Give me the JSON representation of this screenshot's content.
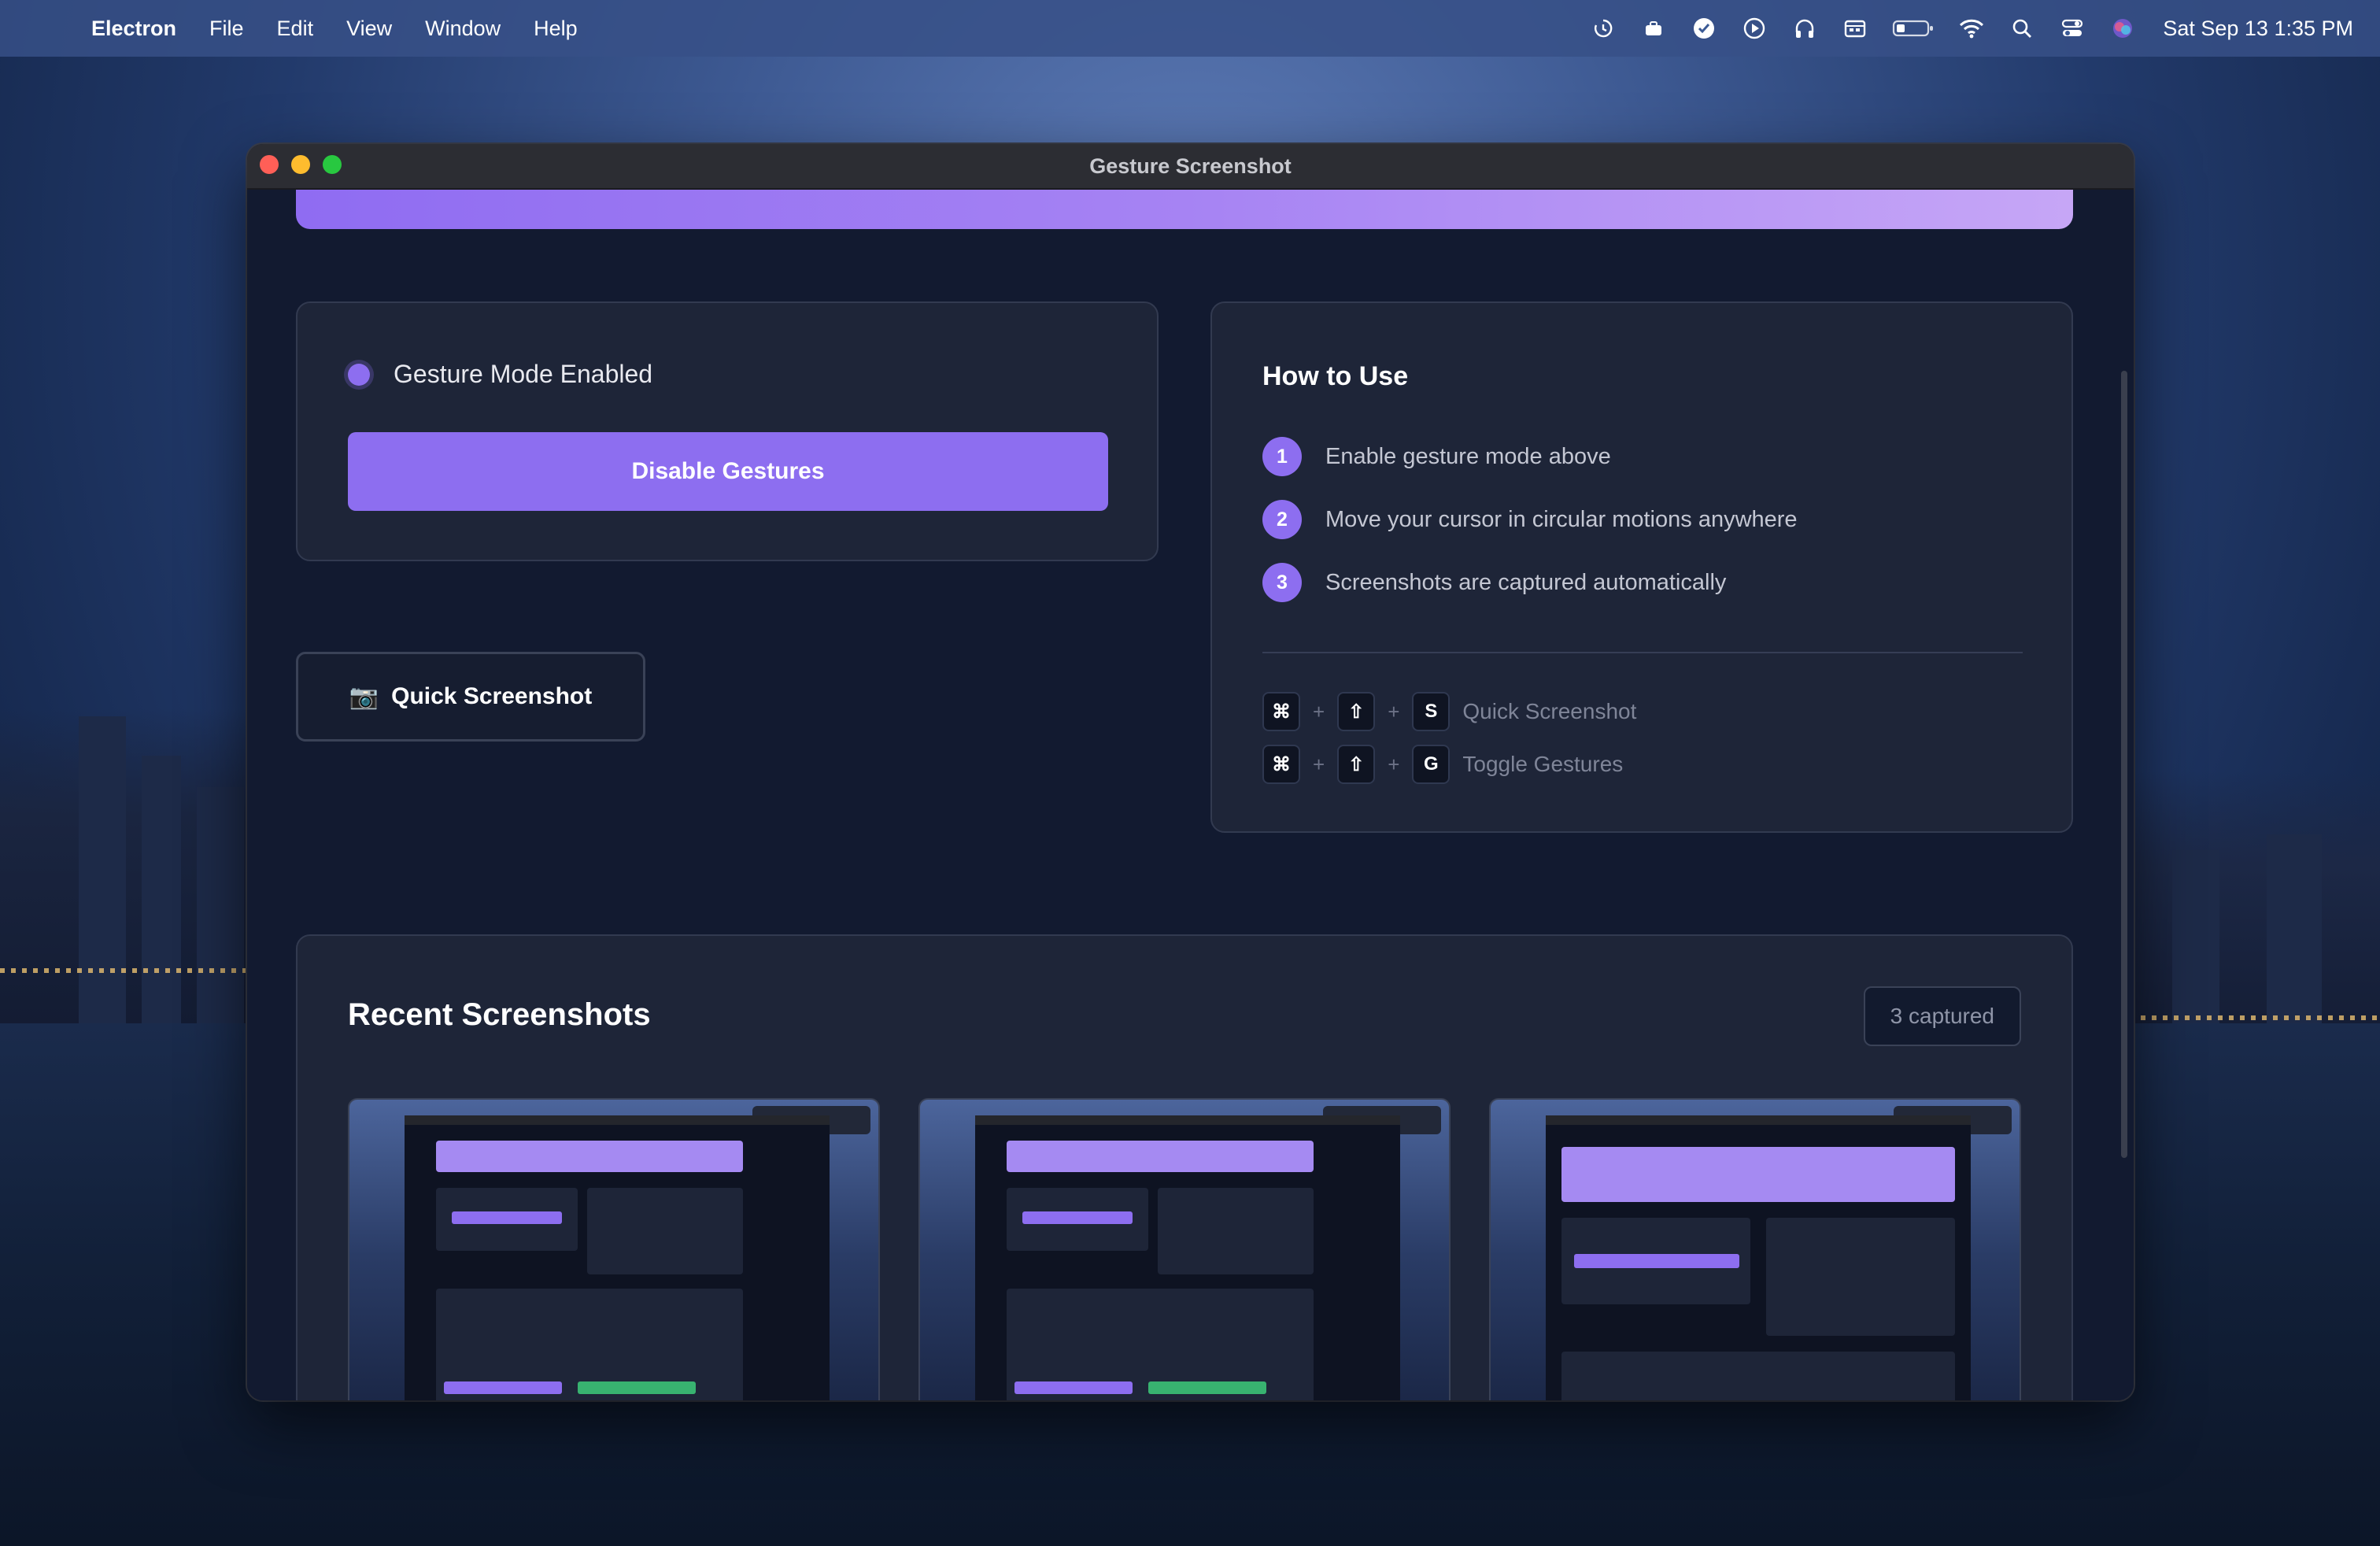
{
  "menubar": {
    "app_name": "Electron",
    "items": [
      "File",
      "Edit",
      "View",
      "Window",
      "Help"
    ],
    "clock": "Sat Sep 13  1:35 PM"
  },
  "window": {
    "title": "Gesture Screenshot"
  },
  "status": {
    "label": "Gesture Mode Enabled",
    "toggle_button": "Disable Gestures"
  },
  "quick_button": {
    "icon": "📷",
    "label": "Quick Screenshot"
  },
  "howto": {
    "title": "How to Use",
    "steps": [
      {
        "num": "1",
        "text": "Enable gesture mode above"
      },
      {
        "num": "2",
        "text": "Move your cursor in circular motions anywhere"
      },
      {
        "num": "3",
        "text": "Screenshots are captured automatically"
      }
    ],
    "shortcuts": [
      {
        "keys": [
          "⌘",
          "⇧",
          "S"
        ],
        "label": "Quick Screenshot"
      },
      {
        "keys": [
          "⌘",
          "⇧",
          "G"
        ],
        "label": "Toggle Gestures"
      }
    ],
    "plus": "+"
  },
  "recent": {
    "title": "Recent Screenshots",
    "badge": "3 captured"
  },
  "colors": {
    "accent": "#8d6ef0",
    "banner_start": "#8f6cf2",
    "banner_end": "#c6a6f6",
    "card_bg": "#1e2538",
    "window_bg": "#121a30"
  }
}
